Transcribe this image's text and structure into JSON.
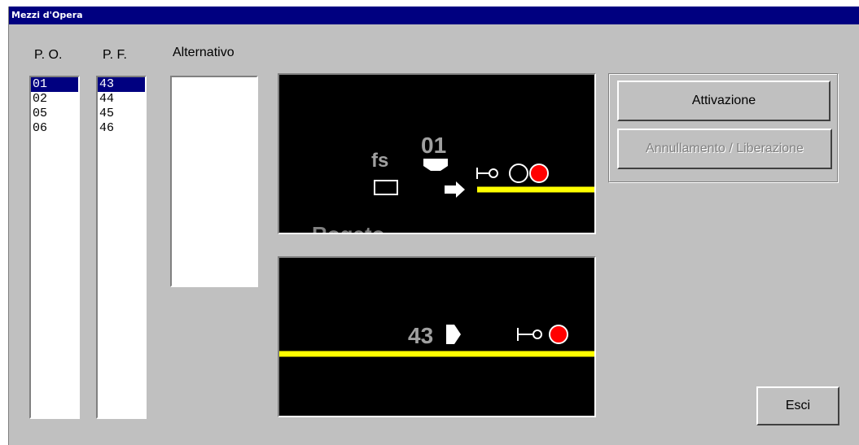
{
  "window": {
    "title": "Mezzi d'Opera"
  },
  "labels": {
    "po": "P. O.",
    "pf": "P. F.",
    "alternativo": "Alternativo"
  },
  "lists": {
    "po": {
      "items": [
        "01",
        "02",
        "05",
        "06"
      ],
      "selected": "01"
    },
    "pf": {
      "items": [
        "43",
        "44",
        "45",
        "46"
      ],
      "selected": "43"
    }
  },
  "panel_top": {
    "fs_label": "fs",
    "route_number": "01",
    "station_partial": "Rogato"
  },
  "panel_bottom": {
    "route_number": "43"
  },
  "buttons": {
    "attivazione": "Attivazione",
    "annullamento": "Annullamento / Liberazione",
    "annullamento_enabled": false,
    "esci": "Esci"
  },
  "colors": {
    "track": "#ffff00",
    "signal_red": "#ff0000",
    "route_text": "#a0a0a0",
    "titlebar": "#000080"
  }
}
